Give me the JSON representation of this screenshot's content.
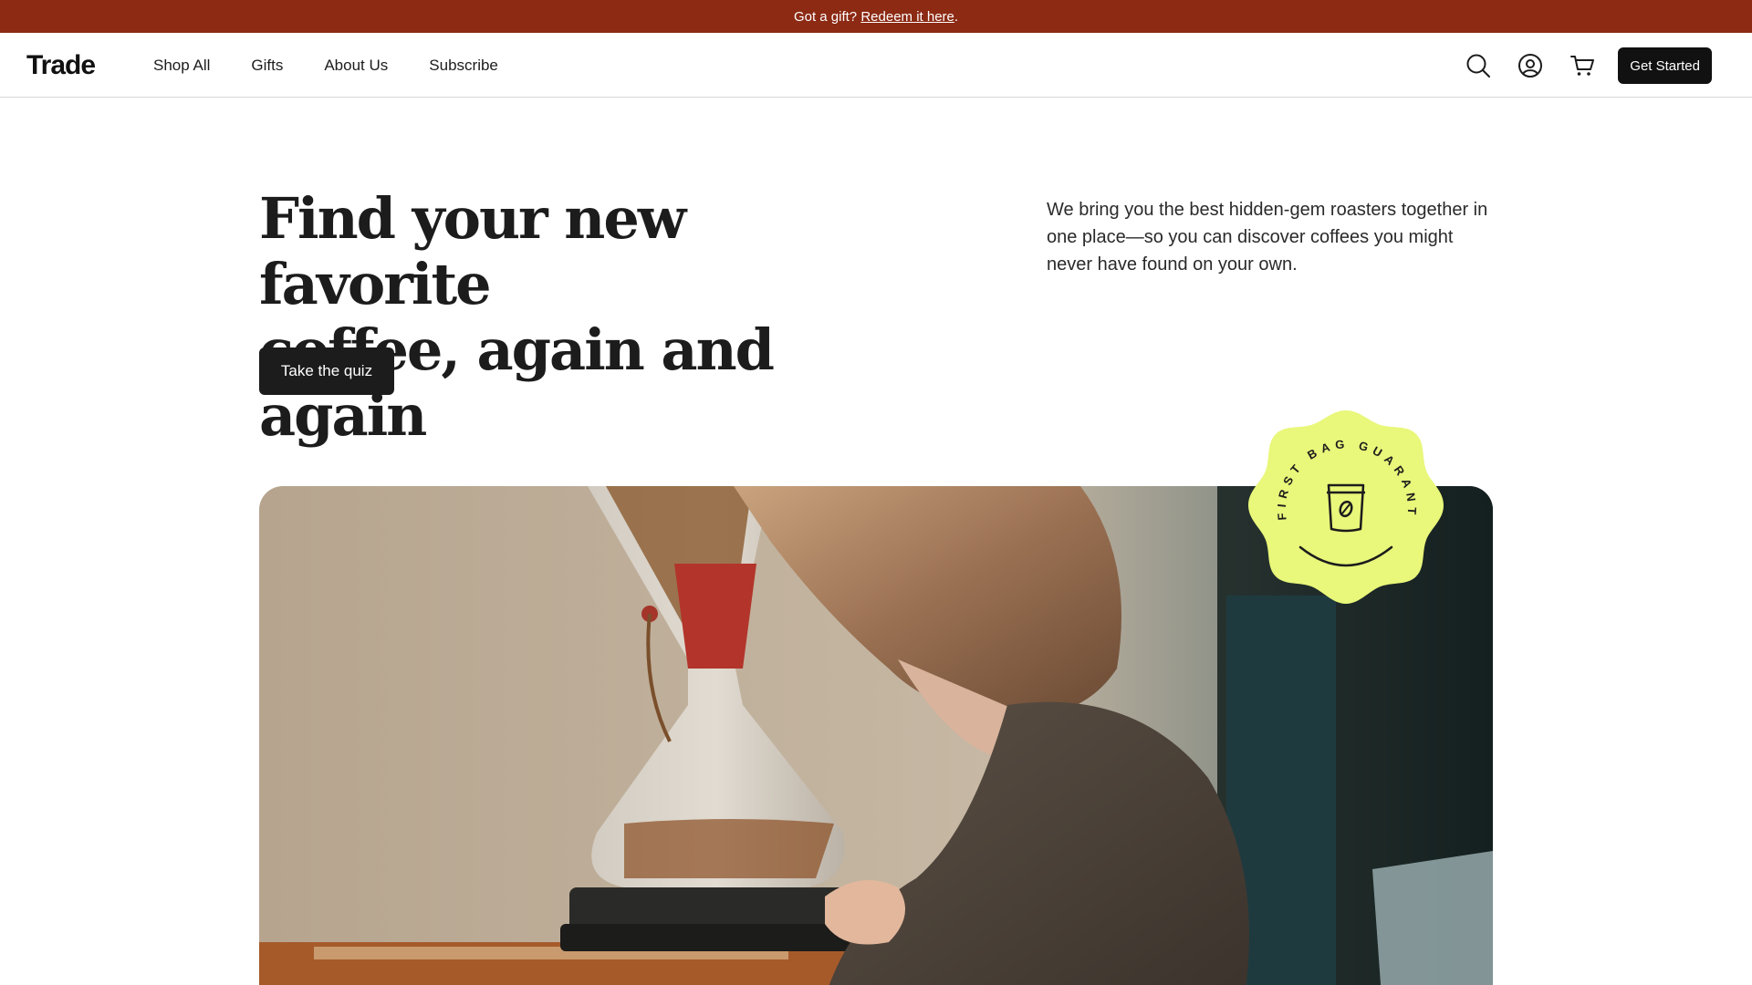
{
  "announcement": {
    "prefix": "Got a gift?",
    "link": "Redeem it here",
    "suffix": "."
  },
  "nav": {
    "logo": "Trade",
    "links": [
      "Shop All",
      "Gifts",
      "About Us",
      "Subscribe"
    ],
    "icons": [
      "search-icon",
      "account-icon",
      "cart-icon"
    ],
    "cta": "Get Started"
  },
  "hero": {
    "title_line1": "Find your new favorite",
    "title_line2": "coffee, again and again",
    "cta": "Take the quiz",
    "description": "We bring you the best hidden-gem roasters together in one place—so you can discover coffees you might never have found on your own."
  },
  "badge": {
    "text": "FIRST BAG GUARANTEED",
    "color": "#e9f77a"
  },
  "colors": {
    "announcement_bg": "#8c2a14",
    "button_bg": "#111111",
    "text": "#1c1c1c"
  }
}
